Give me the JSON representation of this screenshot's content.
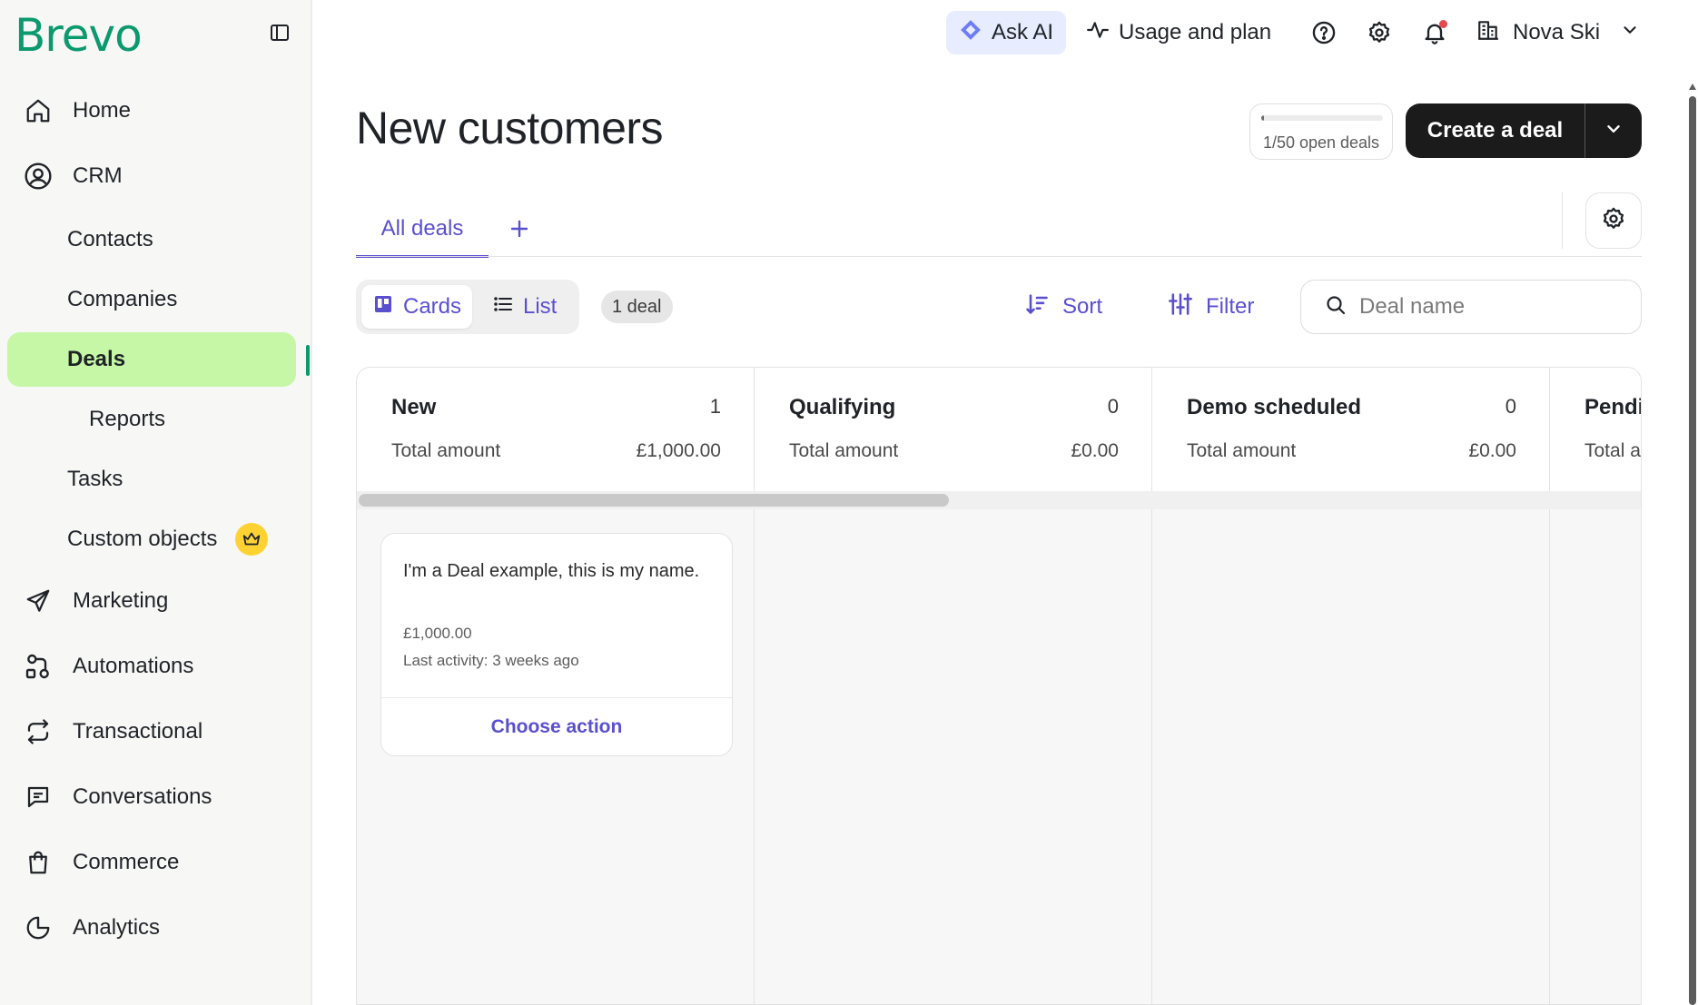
{
  "brand": {
    "logo": "Brevo",
    "color": "#0b996e"
  },
  "sidebar": {
    "items": [
      {
        "label": "Home",
        "icon": "home-icon"
      },
      {
        "label": "CRM",
        "icon": "user-circle-icon"
      },
      {
        "label": "Contacts"
      },
      {
        "label": "Companies"
      },
      {
        "label": "Deals",
        "active": true
      },
      {
        "label": "Reports"
      },
      {
        "label": "Tasks"
      },
      {
        "label": "Custom objects",
        "badge_icon": "crown-icon"
      },
      {
        "label": "Marketing",
        "icon": "send-icon"
      },
      {
        "label": "Automations",
        "icon": "automation-icon"
      },
      {
        "label": "Transactional",
        "icon": "repeat-icon"
      },
      {
        "label": "Conversations",
        "icon": "chat-icon"
      },
      {
        "label": "Commerce",
        "icon": "shopping-bag-icon"
      },
      {
        "label": "Analytics",
        "icon": "pie-chart-icon"
      }
    ],
    "active_color": "#c6f7a6"
  },
  "topbar": {
    "ask_ai": "Ask AI",
    "usage": "Usage and plan",
    "account_name": "Nova Ski"
  },
  "page": {
    "title": "New customers",
    "quota_text": "1/50 open deals",
    "quota_fraction": 0.02,
    "create_button": "Create a deal"
  },
  "tabs": {
    "active": "All deals"
  },
  "toolbar": {
    "cards": "Cards",
    "list": "List",
    "count": "1 deal",
    "sort": "Sort",
    "filter": "Filter",
    "search_placeholder": "Deal name",
    "accent": "#5a4fcf"
  },
  "board": {
    "columns": [
      {
        "name": "New",
        "count": "1",
        "total_label": "Total amount",
        "total": "£1,000.00"
      },
      {
        "name": "Qualifying",
        "count": "0",
        "total_label": "Total amount",
        "total": "£0.00"
      },
      {
        "name": "Demo scheduled",
        "count": "0",
        "total_label": "Total amount",
        "total": "£0.00"
      },
      {
        "name": "Pendi",
        "total_label": "Total a"
      }
    ],
    "card": {
      "name": "I'm a Deal example, this is my name.",
      "amount": "£1,000.00",
      "activity": "Last activity: 3 weeks ago",
      "action": "Choose action"
    }
  }
}
